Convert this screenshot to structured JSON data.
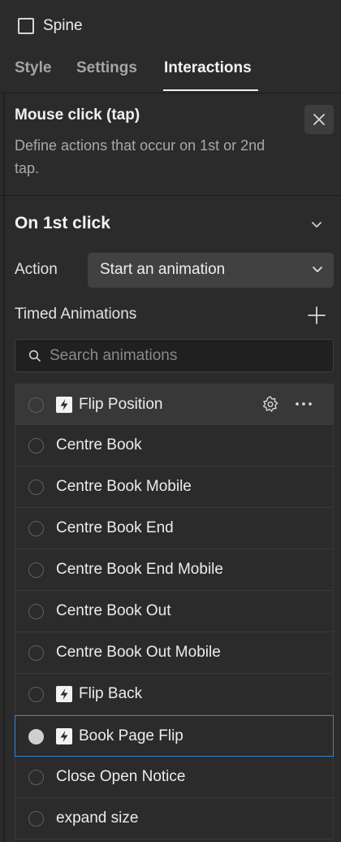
{
  "header": {
    "title": "Spine"
  },
  "tabs": [
    {
      "label": "Style"
    },
    {
      "label": "Settings"
    },
    {
      "label": "Interactions"
    }
  ],
  "trigger": {
    "title": "Mouse click (tap)",
    "description": "Define actions that occur on 1st or 2nd tap."
  },
  "section": {
    "title": "On 1st click"
  },
  "action": {
    "label": "Action",
    "value": "Start an animation"
  },
  "timed_animations": {
    "label": "Timed Animations",
    "search_placeholder": "Search animations",
    "items": [
      {
        "name": "Flip Position",
        "bolt": true,
        "state": "hover"
      },
      {
        "name": "Centre Book",
        "bolt": false,
        "state": "normal"
      },
      {
        "name": "Centre Book Mobile",
        "bolt": false,
        "state": "normal"
      },
      {
        "name": "Centre Book End",
        "bolt": false,
        "state": "normal"
      },
      {
        "name": "Centre Book End Mobile",
        "bolt": false,
        "state": "normal"
      },
      {
        "name": "Centre Book Out",
        "bolt": false,
        "state": "normal"
      },
      {
        "name": "Centre Book Out Mobile",
        "bolt": false,
        "state": "normal"
      },
      {
        "name": "Flip Back",
        "bolt": true,
        "state": "normal"
      },
      {
        "name": "Book Page Flip",
        "bolt": true,
        "state": "selected"
      },
      {
        "name": "Close Open Notice",
        "bolt": false,
        "state": "normal"
      },
      {
        "name": "expand size",
        "bolt": false,
        "state": "normal"
      }
    ]
  },
  "colors": {
    "panel_bg": "#2b2b2b",
    "selected_border": "#2f86d6",
    "hover_bg": "#383838"
  }
}
